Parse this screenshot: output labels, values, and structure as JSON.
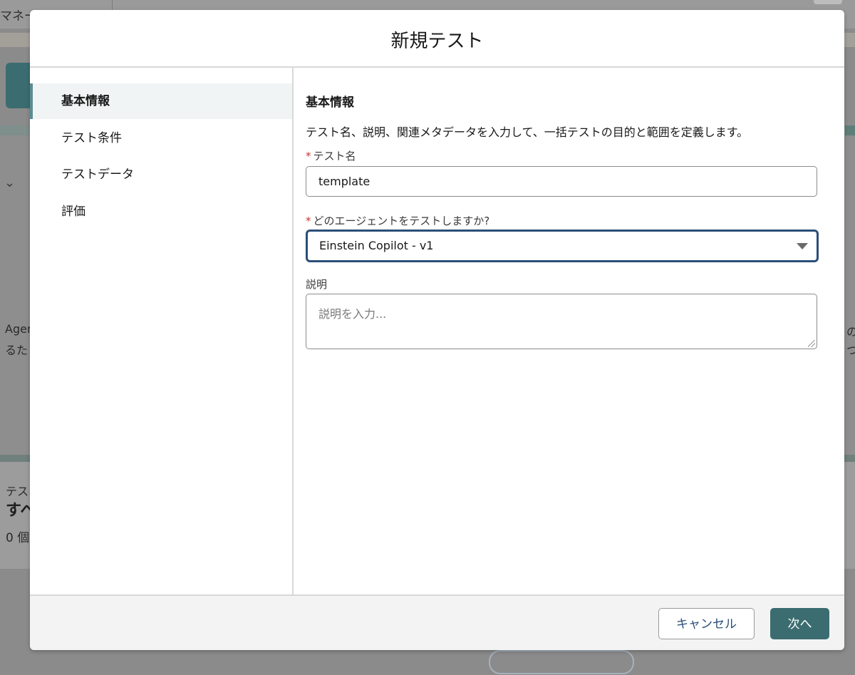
{
  "background": {
    "top_tab_text": "マネー",
    "left_text_1": "Agen",
    "left_text_2": "るた",
    "right_text_1": "の",
    "right_text_2": "つ",
    "lower_label": "テス",
    "lower_heading": "すべ",
    "lower_count": "0 個"
  },
  "modal": {
    "title": "新規テスト",
    "nav": {
      "items": [
        {
          "label": "基本情報",
          "active": true
        },
        {
          "label": "テスト条件",
          "active": false
        },
        {
          "label": "テストデータ",
          "active": false
        },
        {
          "label": "評価",
          "active": false
        }
      ]
    },
    "content": {
      "section_title": "基本情報",
      "section_description": "テスト名、説明、関連メタデータを入力して、一括テストの目的と範囲を定義します。",
      "test_name": {
        "required_mark": "*",
        "label": "テスト名",
        "value": "template"
      },
      "agent_select": {
        "required_mark": "*",
        "label": "どのエージェントをテストしますか?",
        "selected": "Einstein Copilot - v1"
      },
      "description": {
        "label": "説明",
        "placeholder": "説明を入力..."
      }
    },
    "footer": {
      "cancel_label": "キャンセル",
      "next_label": "次へ"
    }
  },
  "colors": {
    "accent": "#3b6d70",
    "focus_border": "#2b4e78",
    "required": "#c23934"
  }
}
